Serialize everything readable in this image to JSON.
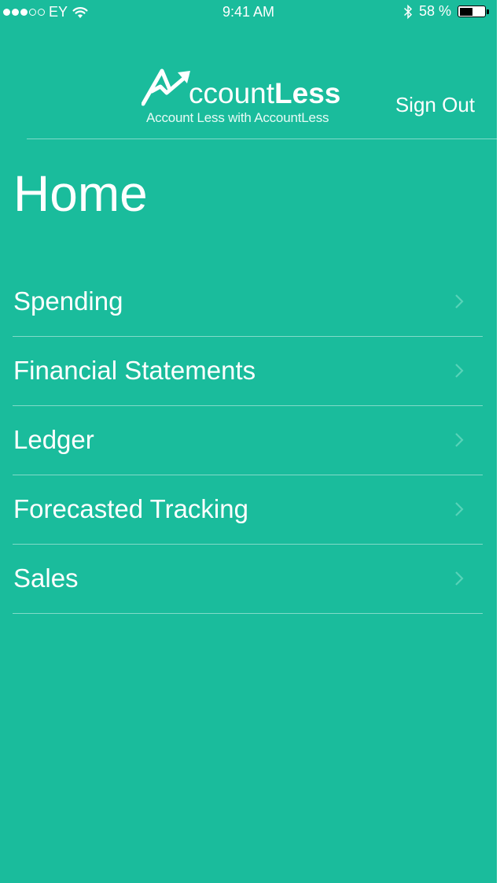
{
  "status_bar": {
    "carrier": "EY",
    "time": "9:41 AM",
    "battery_percent": "58 %",
    "battery_level": 0.58,
    "signal_bars_filled": 3,
    "signal_bars_total": 5
  },
  "header": {
    "logo_text_light": "ccount",
    "logo_text_bold": "Less",
    "logo_tagline": "Account Less with AccountLess",
    "sign_out_label": "Sign Out"
  },
  "page": {
    "title": "Home"
  },
  "menu": {
    "items": [
      {
        "label": "Spending"
      },
      {
        "label": "Financial Statements"
      },
      {
        "label": "Ledger"
      },
      {
        "label": "Forecasted Tracking"
      },
      {
        "label": "Sales"
      }
    ]
  },
  "colors": {
    "background": "#1abc9c",
    "text": "#ffffff"
  }
}
